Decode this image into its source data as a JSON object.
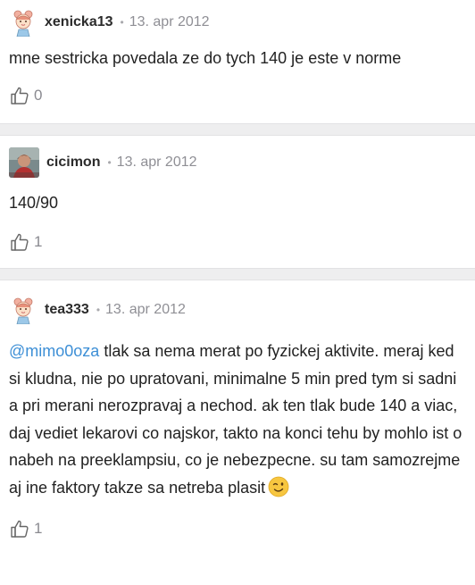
{
  "comments": [
    {
      "username": "xenicka13",
      "date": "13. apr 2012",
      "separator": "•",
      "avatar_icon": "girl-doll-avatar-icon",
      "text": "mne sestricka povedala ze do tych 140 je este v norme",
      "likes": "0"
    },
    {
      "username": "cicimon",
      "date": "13. apr 2012",
      "separator": "•",
      "avatar_icon": "photo-avatar",
      "text": "140/90",
      "likes": "1"
    },
    {
      "username": "tea333",
      "date": "13. apr 2012",
      "separator": "•",
      "avatar_icon": "girl-doll-avatar-icon",
      "mention": "@mimo0oza",
      "text": " tlak sa nema merat po fyzickej aktivite. meraj ked si kludna, nie po upratovani, minimalne 5 min pred tym si sadni a pri merani nerozpravaj a nechod. ak ten tlak bude 140 a viac, daj vediet lekarovi co najskor, takto na konci tehu by mohlo ist o nabeh na preeklampsiu, co je nebezpecne. su tam samozrejme aj ine faktory takze sa netreba plasit",
      "emoji_icon": "winking-face-icon",
      "likes": "1"
    }
  ],
  "colors": {
    "mention": "#3d8fd6",
    "divider": "#eeeeef",
    "meta": "#8f8f95",
    "emoji": "#f7c640"
  }
}
